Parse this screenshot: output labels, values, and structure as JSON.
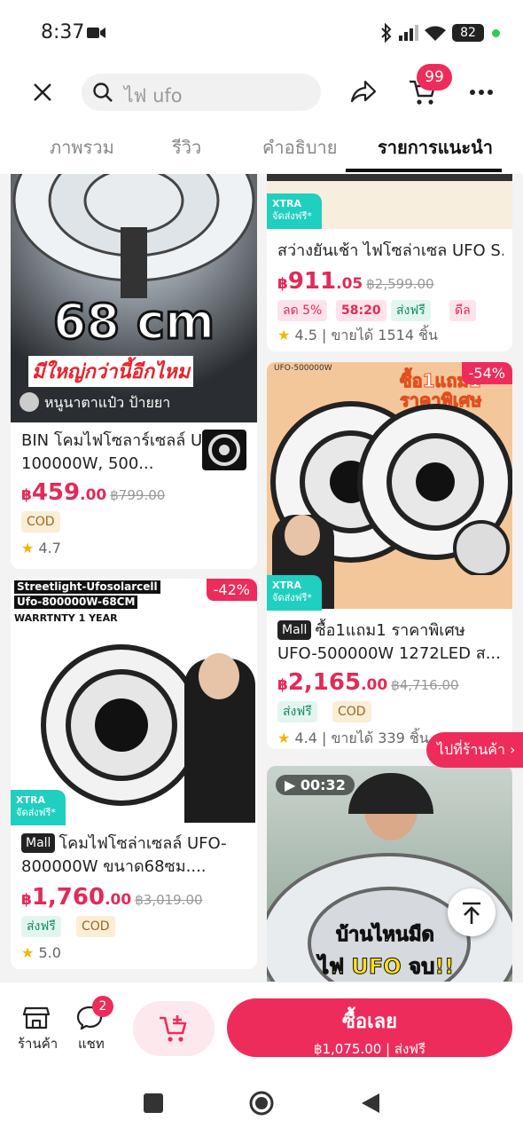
{
  "status": {
    "time": "8:37",
    "battery": "82"
  },
  "search": {
    "query": "ไฟ ufo"
  },
  "cart": {
    "badge": "99"
  },
  "tabs": [
    {
      "label": "ภาพรวม"
    },
    {
      "label": "รีวิว"
    },
    {
      "label": "คำอธิบาย"
    },
    {
      "label": "รายการแนะนำ"
    }
  ],
  "products": [
    {
      "image_text": "68 cm",
      "image_sub": "มีใหญ่กว่านี้อีกไหม",
      "image_user": "หนูนาตาแป๋ว ป้ายยา",
      "title": "BIN โคมไฟโซลาร์เซลล์ UFO 100000W, 500...",
      "currency": "฿",
      "price_int": "459",
      "price_dec": ".00",
      "original_price": "฿799.00",
      "tags": [
        "COD"
      ],
      "rating": "4.7"
    },
    {
      "image_lines": [
        "Streetlight-Ufosolarcell",
        "Ufo-800000W-68CM",
        "WARRTNTY 1 YEAR"
      ],
      "discount": "-42%",
      "xtra": "XTRA",
      "xtra_sub": "จัดส่งฟรี*",
      "mall": "Mall",
      "title": "โคมไฟโซล่าเซลล์ UFO-800000W ขนาด68ซม....",
      "currency": "฿",
      "price_int": "1,760",
      "price_dec": ".00",
      "original_price": "฿3,019.00",
      "tags": [
        "ส่งฟรี",
        "COD"
      ],
      "rating": "5.0"
    },
    {
      "xtra": "XTRA",
      "xtra_sub": "จัดส่งฟรี*",
      "title": "สว่างยันเช้า ไฟโซล่าเซล UFO S...",
      "currency": "฿",
      "price_int": "911",
      "price_dec": ".05",
      "original_price": "฿2,599.00",
      "tags": [
        "ลด 5%",
        "58:20",
        "ส่งฟรี",
        "ดีล"
      ],
      "rating": "4.5",
      "sold": "ขายได้ 1514 ชิ้น"
    },
    {
      "image_headline": "ซื้อ1แถม1 ราคาพิเศษ",
      "image_small": "UFO-500000W",
      "discount": "-54%",
      "xtra": "XTRA",
      "xtra_sub": "จัดส่งฟรี*",
      "mall": "Mall",
      "title": "ซื้อ1แถม1 ราคาพิเศษ UFO-500000W 1272LED ส...",
      "currency": "฿",
      "price_int": "2,165",
      "price_dec": ".00",
      "original_price": "฿4,716.00",
      "tags": [
        "ส่งฟรี",
        "COD"
      ],
      "rating": "4.4",
      "sold": "ขายได้ 339 ชิ้น"
    },
    {
      "video_time": "00:32",
      "caption_1": "บ้านไหนมืด",
      "caption_2": "ไฟ UFO จบ!!"
    }
  ],
  "floating": {
    "shop_link": "ไปที่ร้านค้า"
  },
  "bottom": {
    "shop_label": "ร้านค้า",
    "chat_label": "แชท",
    "chat_badge": "2",
    "buy_label": "ซื้อเลย",
    "buy_sub": "฿1,075.00 | ส่งฟรี"
  },
  "colors": {
    "accent": "#ee2c5b",
    "teal": "#1fcfc0"
  }
}
